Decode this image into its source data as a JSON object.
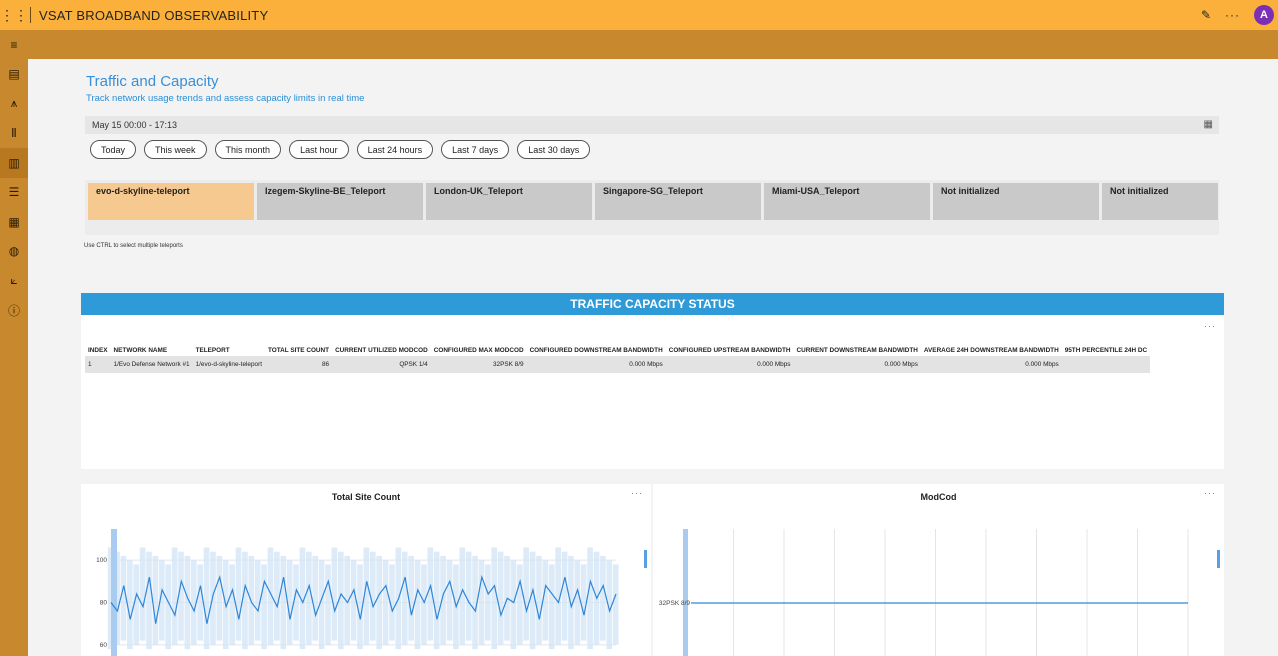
{
  "app": {
    "title": "VSAT BROADBAND OBSERVABILITY",
    "avatar_initial": "A",
    "apps_icon": "grid-icon",
    "edit_icon": "pencil-icon",
    "more_icon": "ellipsis-icon"
  },
  "sidebar": {
    "items": [
      {
        "name": "menu",
        "glyph": "≡"
      },
      {
        "name": "dashboard",
        "glyph": "▤"
      },
      {
        "name": "network",
        "glyph": "⩚"
      },
      {
        "name": "antenna",
        "glyph": "Ⅱ"
      },
      {
        "name": "traffic",
        "glyph": "▥"
      },
      {
        "name": "list",
        "glyph": "☰"
      },
      {
        "name": "report",
        "glyph": "▦"
      },
      {
        "name": "globe",
        "glyph": "◍"
      },
      {
        "name": "analytics",
        "glyph": "⟀"
      },
      {
        "name": "info",
        "glyph": "ⓘ"
      }
    ]
  },
  "page": {
    "title": "Traffic and Capacity",
    "subtitle": "Track network usage trends and assess capacity limits in real time"
  },
  "date_range": "May 15 00:00 - 17:13",
  "quick_ranges": [
    "Today",
    "This week",
    "This month",
    "Last hour",
    "Last 24 hours",
    "Last 7 days",
    "Last 30 days"
  ],
  "teleports": [
    {
      "label": "evo-d-skyline-teleport",
      "selected": true
    },
    {
      "label": "Izegem-Skyline-BE_Teleport",
      "selected": false
    },
    {
      "label": "London-UK_Teleport",
      "selected": false
    },
    {
      "label": "Singapore-SG_Teleport",
      "selected": false
    },
    {
      "label": "Miami-USA_Teleport",
      "selected": false
    },
    {
      "label": "Not initialized",
      "selected": false
    },
    {
      "label": "Not initialized",
      "selected": false
    }
  ],
  "ctrl_note": "Use CTRL to select multiple teleports",
  "status": {
    "title": "TRAFFIC CAPACITY STATUS",
    "more": "···",
    "columns": [
      "INDEX",
      "NETWORK NAME",
      "TELEPORT",
      "TOTAL SITE COUNT",
      "CURRENT UTILIZED MODCOD",
      "CONFIGURED MAX MODCOD",
      "CONFIGURED DOWNSTREAM BANDWIDTH",
      "CONFIGURED UPSTREAM BANDWIDTH",
      "CURRENT DOWNSTREAM BANDWIDTH",
      "AVERAGE 24H DOWNSTREAM BANDWIDTH",
      "95TH PERCENTILE 24H DC"
    ],
    "rows": [
      [
        "1",
        "1/Evo Defense Network #1",
        "1/evo-d-skyline-teleport",
        "86",
        "QPSK 1/4",
        "32PSK 8/9",
        "0.000 Mbps",
        "0.000 Mbps",
        "0.000 Mbps",
        "0.000 Mbps",
        ""
      ]
    ]
  },
  "charts": {
    "site_count": {
      "title": "Total Site Count",
      "more": "···"
    },
    "modcod": {
      "title": "ModCod",
      "more": "···"
    }
  },
  "chart_data": [
    {
      "type": "line",
      "title": "Total Site Count",
      "yticks": [
        "100",
        "80",
        "60"
      ],
      "ylim": [
        50,
        110
      ],
      "series": [
        {
          "values": [
            80,
            76,
            88,
            72,
            84,
            78,
            92,
            70,
            86,
            80,
            74,
            90,
            82,
            76,
            88,
            70,
            84,
            92,
            78,
            86,
            72,
            88,
            80,
            76,
            90,
            84,
            78,
            92,
            72,
            86,
            80,
            88,
            74,
            82,
            90,
            76,
            84,
            80,
            86,
            72,
            90,
            78,
            84,
            88,
            76,
            82,
            92,
            74,
            86,
            80,
            88,
            72,
            84,
            90,
            78,
            86,
            80,
            76,
            92,
            84,
            88,
            74,
            82,
            80,
            90,
            76,
            86,
            72,
            88,
            84,
            80,
            92,
            78,
            86,
            74,
            90,
            82,
            88,
            76,
            84
          ]
        }
      ],
      "band_upper": 106,
      "band_lower": 58
    },
    {
      "type": "line",
      "title": "ModCod",
      "yticks": [
        "32PSK 8/9"
      ],
      "series": [
        {
          "values": [
            1,
            1,
            1,
            1,
            1,
            1,
            1,
            1,
            1,
            1,
            1
          ]
        }
      ]
    }
  ]
}
